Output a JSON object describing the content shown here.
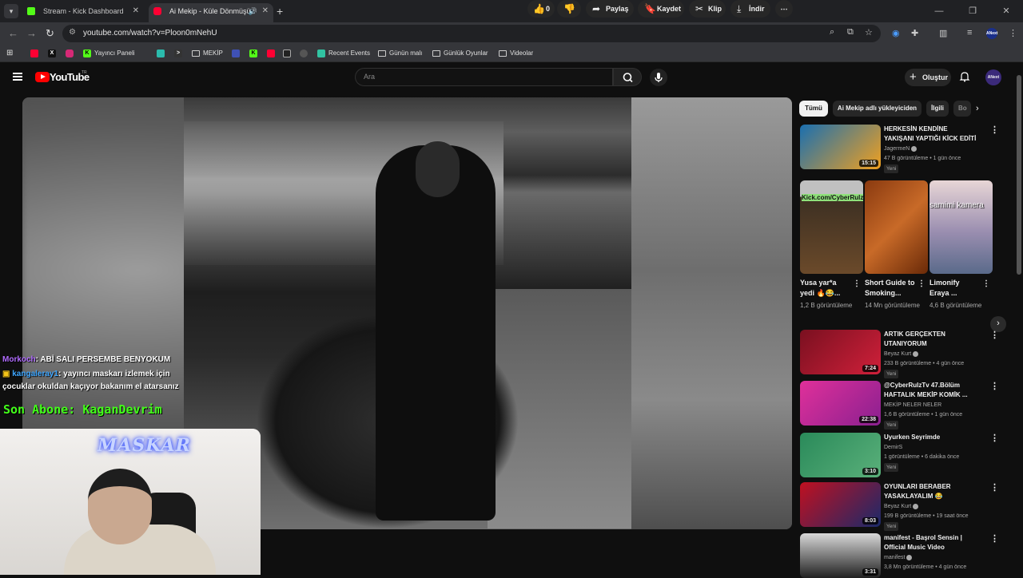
{
  "browser": {
    "tabs": [
      {
        "title": "Stream - Kick Dashboard",
        "favicon_color": "#53fc18",
        "favicon_letter": "K"
      },
      {
        "title": "Ai Mekip - Küle Dönmüşün",
        "favicon_color": "#ff0033",
        "favicon_letter": ""
      }
    ],
    "url": "youtube.com/watch?v=Ploon0mNehU",
    "profile": "ANext",
    "bookmarks": [
      {
        "label": "",
        "icon": "youtube-icon",
        "color": "#ff0033"
      },
      {
        "label": "",
        "icon": "x-icon",
        "color": "#000000"
      },
      {
        "label": "",
        "icon": "instagram-icon",
        "color": "#d62976"
      },
      {
        "label": "Yayıncı Paneli",
        "icon": "kick-icon",
        "color": "#53fc18"
      },
      {
        "label": "",
        "icon": "app-icon",
        "color": "#2bbbad"
      },
      {
        "label": "",
        "icon": "terminal-icon",
        "color": "#333333"
      },
      {
        "label": "MEKİP",
        "icon": "folder-icon",
        "color": ""
      },
      {
        "label": "",
        "icon": "app-icon",
        "color": "#3f51b5"
      },
      {
        "label": "",
        "icon": "kick-icon",
        "color": "#53fc18"
      },
      {
        "label": "",
        "icon": "youtube-icon",
        "color": "#ff0033"
      },
      {
        "label": "",
        "icon": "image-icon",
        "color": "#222222"
      },
      {
        "label": "",
        "icon": "chat-icon",
        "color": "#555555"
      },
      {
        "label": "Recent Events",
        "icon": "streamlabs-icon",
        "color": "#31c3a2"
      },
      {
        "label": "Günün malı",
        "icon": "folder-icon",
        "color": ""
      },
      {
        "label": "Günlük Oyunlar",
        "icon": "folder-icon",
        "color": ""
      },
      {
        "label": "Videolar",
        "icon": "folder-icon",
        "color": ""
      }
    ]
  },
  "youtube": {
    "logo_text": "YouTube",
    "region": "TR",
    "search_placeholder": "Ara",
    "create_label": "Oluştur",
    "avatar_label": "ANext"
  },
  "overlay": {
    "chat": [
      {
        "user": "Morkoch",
        "message": ": ABİ SALI PERSEMBE BENYOKUM"
      },
      {
        "user": "kangaleray1",
        "message": ": yayıncı maskarı izlemek için çocuklar okuldan kaçıyor bakanım el atarsanız"
      }
    ],
    "last_sub": "Son Abone: KaganDevrim",
    "cam_brand": "MASKAR"
  },
  "actions": {
    "likes": "0",
    "share": "Paylaş",
    "save": "Kaydet",
    "clip": "Klip",
    "download": "İndir"
  },
  "sidebar": {
    "chips": [
      "Tümü",
      "Ai Mekip adlı yükleyiciden",
      "İlgili",
      "Bo"
    ],
    "recommendations_top": [
      {
        "title": "HERKESİN KENDİNE YAKIŞANI YAPTIĞI KİCK EDİTİ",
        "channel": "JagermeN",
        "meta": "47 B görüntüleme • 1 gün önce",
        "badge": "Yeni",
        "duration": "15:15",
        "colors": [
          "#1a6fb0",
          "#f0a020"
        ]
      }
    ],
    "shorts": [
      {
        "title": "Yusa yar*a yedi 🔥😂...",
        "views": "1,2 B görüntüleme",
        "caption": "Kick.com/CyberRulzTv",
        "colors": [
          "#3c2f22",
          "#6b4a2a"
        ]
      },
      {
        "title": "Short Guide to Smoking...",
        "views": "14 Mn görüntüleme",
        "caption": "",
        "colors": [
          "#8a3a10",
          "#c86a28"
        ]
      },
      {
        "title": "Limonify Eraya ...",
        "views": "4,6 B görüntüleme",
        "caption": "samimi kamera",
        "colors": [
          "#e8d6d6",
          "#9a8eb0"
        ]
      }
    ],
    "recommendations": [
      {
        "title": "ARTIK GERÇEKTEN UTANIYORUM",
        "channel": "Beyaz Kurt",
        "verified": true,
        "meta": "233 B görüntüleme • 4 gün önce",
        "badge": "Yeni",
        "duration": "7:24",
        "colors": [
          "#7a1020",
          "#d0203a"
        ]
      },
      {
        "title": "@CyberRulzTv 47.Bölüm HAFTALIK MEKİP KOMİK ...",
        "channel": "MEKİP NELER NELER",
        "verified": false,
        "meta": "1,6 B görüntüleme • 1 gün önce",
        "badge": "Yeni",
        "duration": "22:38",
        "colors": [
          "#e0309a",
          "#8a2090"
        ]
      },
      {
        "title": "Uyurken Seyrimde",
        "channel": "DemirS",
        "verified": false,
        "meta": "1 görüntüleme • 6 dakika önce",
        "badge": "Yeni",
        "duration": "3:10",
        "colors": [
          "#2a8a5a",
          "#5ab07a"
        ]
      },
      {
        "title": "OYUNLARI BERABER YASAKLAYALIM 😂",
        "channel": "Beyaz Kurt",
        "verified": true,
        "meta": "199 B görüntüleme • 19 saat önce",
        "badge": "Yeni",
        "duration": "8:03",
        "colors": [
          "#c01020",
          "#1a2a6a"
        ]
      },
      {
        "title": "manifest - Başrol Sensin | Official Music Video",
        "channel": "manifest",
        "verified": true,
        "meta": "3,8 Mn görüntüleme • 4 gün önce",
        "badge": "",
        "duration": "3:31",
        "colors": [
          "#d8d8d8",
          "#202020"
        ]
      }
    ]
  }
}
